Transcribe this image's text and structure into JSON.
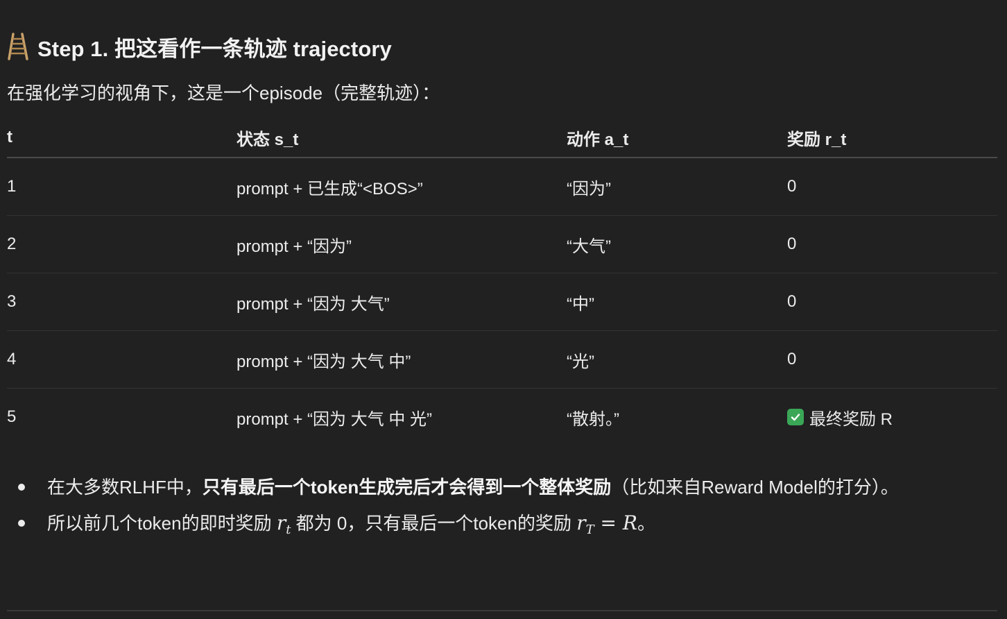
{
  "heading": {
    "icon": "ladder-icon",
    "title": "Step 1. 把这看作一条轨迹 trajectory"
  },
  "intro": "在强化学习的视角下，这是一个episode（完整轨迹）：",
  "table": {
    "columns": [
      "t",
      "状态 s_t",
      "动作 a_t",
      "奖励 r_t"
    ],
    "rows": [
      {
        "t": "1",
        "state": "prompt + 已生成“<BOS>”",
        "action": "“因为”",
        "reward": "0"
      },
      {
        "t": "2",
        "state": "prompt + “因为”",
        "action": "“大气”",
        "reward": "0"
      },
      {
        "t": "3",
        "state": "prompt + “因为 大气”",
        "action": "“中”",
        "reward": "0"
      },
      {
        "t": "4",
        "state": "prompt + “因为 大气 中”",
        "action": "“光”",
        "reward": "0"
      },
      {
        "t": "5",
        "state": "prompt + “因为 大气 中 光”",
        "action": "“散射。”",
        "reward": "最终奖励 R",
        "reward_icon": "check-mark-icon"
      }
    ]
  },
  "bullets": [
    {
      "pre": "在大多数RLHF中，",
      "bold": "只有最后一个token生成完后才会得到一个整体奖励",
      "post": "（比如来自Reward Model的打分）。"
    },
    {
      "pre": "所以前几个token的即时奖励 ",
      "math1_base": "r",
      "math1_sub": "t",
      "mid": " 都为 0，只有最后一个token的奖励 ",
      "math2_base": "r",
      "math2_sub": "T",
      "math2_rest": " = R",
      "post": "。"
    }
  ],
  "colors": {
    "background": "#212121",
    "text": "#ececec",
    "check": "#3aa757"
  }
}
